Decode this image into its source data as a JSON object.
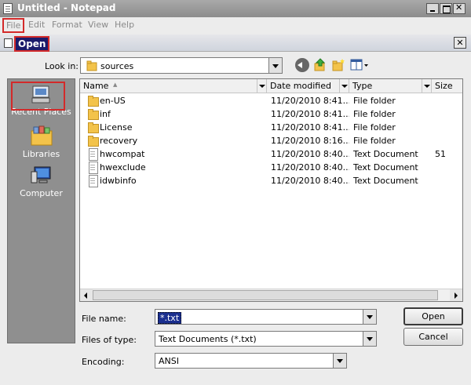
{
  "notepad": {
    "title": "Untitled - Notepad",
    "menu": [
      "File",
      "Edit",
      "Format",
      "View",
      "Help"
    ]
  },
  "dialog": {
    "title": "Open",
    "look_in_label": "Look in:",
    "look_in_value": "sources",
    "places": [
      "Recent Places",
      "Libraries",
      "Computer"
    ],
    "columns": [
      "Name",
      "Date modified",
      "Type",
      "Size"
    ],
    "files": [
      {
        "name": "en-US",
        "date": "11/20/2010 8:41...",
        "type": "File folder",
        "size": "",
        "kind": "folder"
      },
      {
        "name": "inf",
        "date": "11/20/2010 8:41...",
        "type": "File folder",
        "size": "",
        "kind": "folder"
      },
      {
        "name": "License",
        "date": "11/20/2010 8:41...",
        "type": "File folder",
        "size": "",
        "kind": "folder"
      },
      {
        "name": "recovery",
        "date": "11/20/2010 8:16...",
        "type": "File folder",
        "size": "",
        "kind": "folder"
      },
      {
        "name": "hwcompat",
        "date": "11/20/2010 8:40...",
        "type": "Text Document",
        "size": "51",
        "kind": "doc"
      },
      {
        "name": "hwexclude",
        "date": "11/20/2010 8:40...",
        "type": "Text Document",
        "size": "",
        "kind": "doc"
      },
      {
        "name": "idwbinfo",
        "date": "11/20/2010 8:40...",
        "type": "Text Document",
        "size": "",
        "kind": "doc"
      }
    ],
    "file_name_label": "File name:",
    "file_name_value": "*.txt",
    "files_of_type_label": "Files of type:",
    "files_of_type_value": "Text Documents (*.txt)",
    "encoding_label": "Encoding:",
    "encoding_value": "ANSI",
    "open_button": "Open",
    "cancel_button": "Cancel"
  },
  "colors": {
    "highlight_border": "#d32a2a",
    "selection": "#1b2f8f",
    "places_bg": "#8f8f8f"
  }
}
